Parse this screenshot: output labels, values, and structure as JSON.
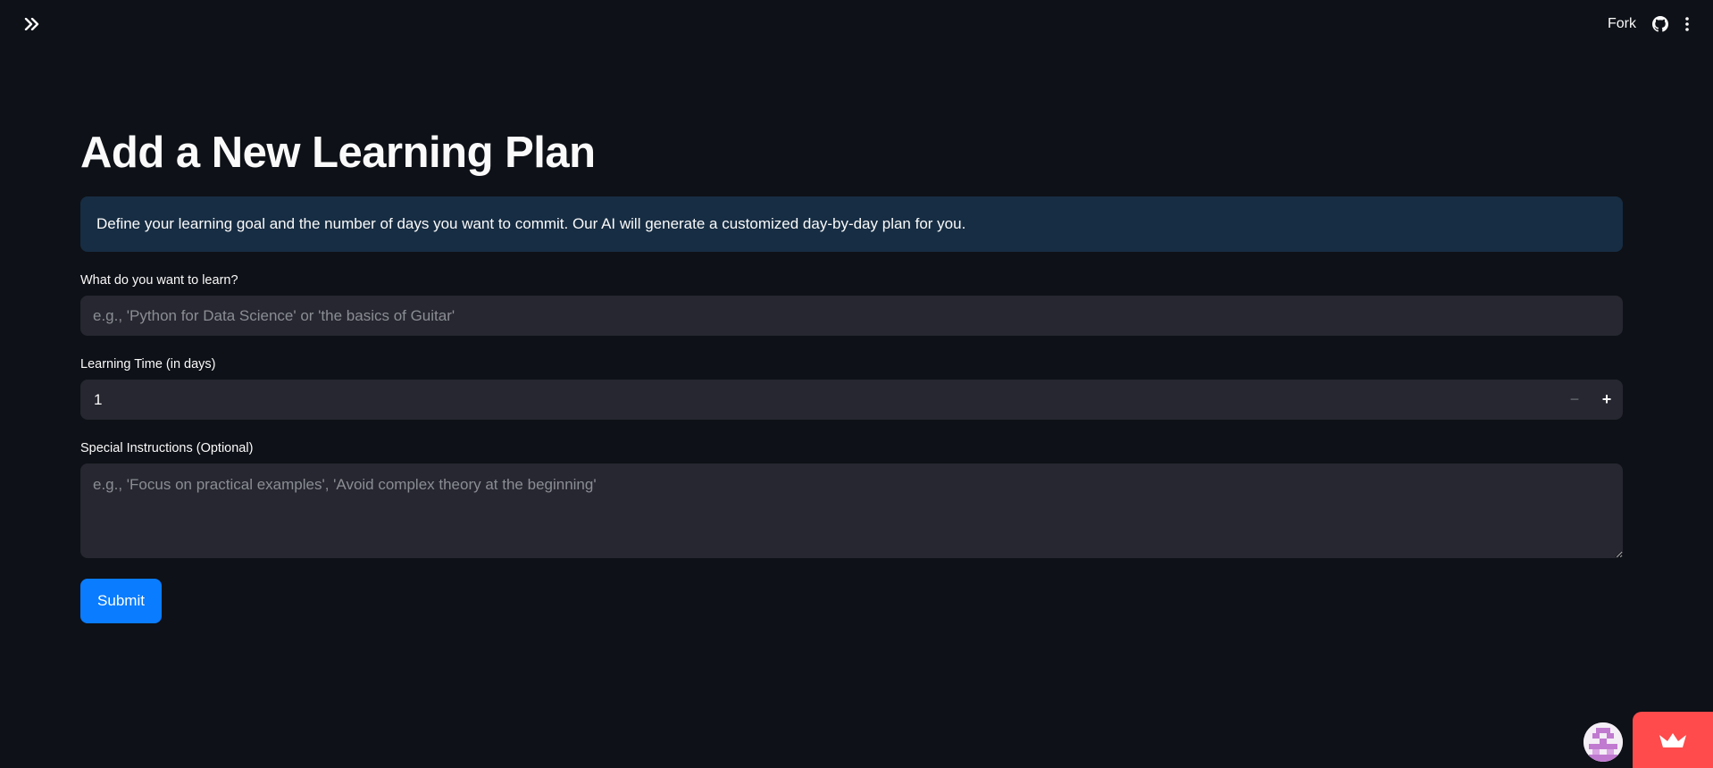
{
  "topbar": {
    "expand_icon": "double-chevron-right-icon",
    "fork_label": "Fork",
    "github_icon": "github-icon",
    "menu_icon": "vertical-ellipsis-icon"
  },
  "main": {
    "title": "Add a New Learning Plan",
    "info_text": "Define your learning goal and the number of days you want to commit. Our AI will generate a customized day-by-day plan for you.",
    "goal_field": {
      "label": "What do you want to learn?",
      "value": "",
      "placeholder": "e.g., 'Python for Data Science' or 'the basics of Guitar'"
    },
    "days_field": {
      "label": "Learning Time (in days)",
      "value": "1",
      "minus": "−",
      "plus": "+"
    },
    "instructions_field": {
      "label": "Special Instructions (Optional)",
      "value": "",
      "placeholder": "e.g., 'Focus on practical examples', 'Avoid complex theory at the beginning'"
    },
    "submit_label": "Submit"
  },
  "colors": {
    "background": "#0e1117",
    "info_box": "#172d43",
    "input_bg": "#262730",
    "primary": "#0a7cff",
    "badge": "#ff4b4b"
  },
  "footer": {
    "avatar_icon": "user-avatar-icon",
    "badge_icon": "streamlit-crown-icon"
  }
}
